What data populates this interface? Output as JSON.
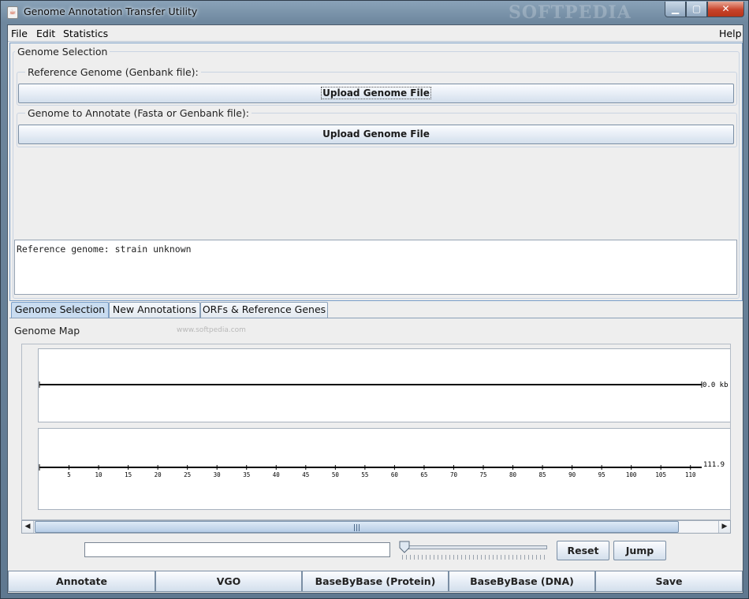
{
  "window": {
    "title": "Genome Annotation Transfer Utility",
    "watermark": "SOFTPEDIA",
    "controls": {
      "minimize": "▁",
      "maximize": "▢",
      "close": "✕"
    }
  },
  "menubar": {
    "items": [
      "File",
      "Edit",
      "Statistics"
    ],
    "help": "Help"
  },
  "genome_selection": {
    "title": "Genome Selection",
    "reference": {
      "label": "Reference Genome (Genbank file):",
      "button": "Upload Genome File"
    },
    "annotate": {
      "label": "Genome to Annotate (Fasta or Genbank file):",
      "button": "Upload Genome File"
    },
    "info_text": "Reference genome: strain unknown"
  },
  "tabs": [
    {
      "label": "Genome Selection",
      "active": true
    },
    {
      "label": "New Annotations",
      "active": false
    },
    {
      "label": "ORFs & Reference Genes",
      "active": false
    }
  ],
  "watermark_url": "www.softpedia.com",
  "genome_map": {
    "title": "Genome Map",
    "track1_label": "0.0 kb",
    "track2_end_label": "111.9",
    "ruler_ticks": [
      5,
      10,
      15,
      20,
      25,
      30,
      35,
      40,
      45,
      50,
      55,
      60,
      65,
      70,
      75,
      80,
      85,
      90,
      95,
      100,
      105,
      110
    ],
    "scroll_left": "◀",
    "scroll_right": "▶"
  },
  "controls": {
    "search_value": "",
    "reset": "Reset",
    "jump": "Jump"
  },
  "bottom_buttons": [
    "Annotate",
    "VGO",
    "BaseByBase (Protein)",
    "BaseByBase (DNA)",
    "Save"
  ]
}
